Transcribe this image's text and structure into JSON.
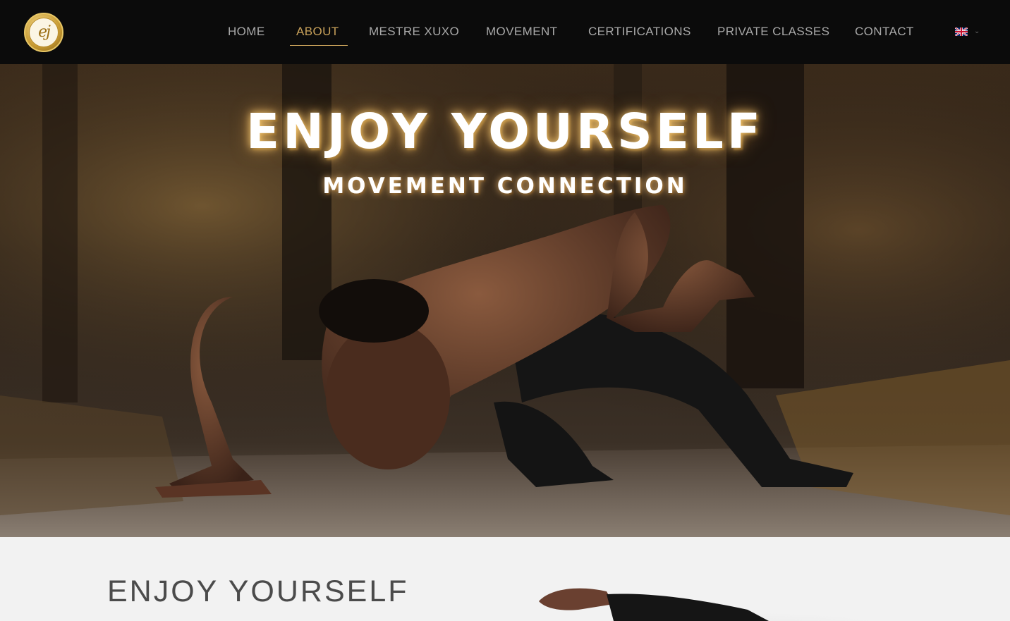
{
  "nav": {
    "logo_text": "ej",
    "items": [
      {
        "label": "HOME",
        "active": false
      },
      {
        "label": "ABOUT",
        "active": true
      },
      {
        "label": "MESTRE XUXO",
        "active": false
      },
      {
        "label": "MOVEMENT",
        "active": false
      },
      {
        "label": "CERTIFICATIONS",
        "active": false
      },
      {
        "label": "PRIVATE CLASSES",
        "active": false
      },
      {
        "label": "CONTACT",
        "active": false
      }
    ],
    "language": {
      "icon": "uk-flag-icon",
      "chevron": "⌄"
    }
  },
  "hero": {
    "title": "ENJOY YOURSELF",
    "subtitle": "MOVEMENT CONNECTION"
  },
  "section": {
    "heading": "ENJOY YOURSELF"
  },
  "colors": {
    "nav_bg": "#0b0b0b",
    "nav_text": "#a9a9a9",
    "accent": "#c8a15a",
    "section_bg": "#f2f2f2",
    "heading_text": "#4b4b4b"
  }
}
